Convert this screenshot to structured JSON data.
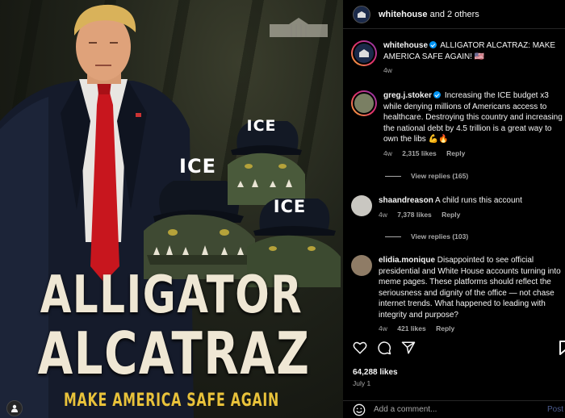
{
  "poster": {
    "cap_text": "ICE",
    "headline_line1": "ALLIGATOR",
    "headline_line2": "ALCATRAZ",
    "tagline": "MAKE AMERICA SAFE AGAIN"
  },
  "header": {
    "username": "whitehouse",
    "suffix": "and 2 others"
  },
  "caption": {
    "username": "whitehouse",
    "text": "ALLIGATOR ALCATRAZ: MAKE AMERICA SAFE AGAIN! 🇺🇸",
    "time": "4w"
  },
  "comments": [
    {
      "username": "greg.j.stoker",
      "text": "Increasing the ICE budget x3 while denying millions of Americans access to healthcare. Destroying this country and increasing the national debt by 4.5 trillion is a great way to own the libs 💪🔥",
      "time": "4w",
      "likes": "2,315 likes",
      "reply": "Reply",
      "view_replies": "View replies (165)"
    },
    {
      "username": "shaandreason",
      "text": "A child runs this account",
      "time": "4w",
      "likes": "7,378 likes",
      "reply": "Reply",
      "view_replies": "View replies (103)"
    },
    {
      "username": "elidia.monique",
      "text": "Disappointed to see official presidential and White House accounts turning into meme pages. These platforms should reflect the seriousness and dignity of the office — not chase internet trends. What happened to leading with integrity and purpose?",
      "time": "4w",
      "likes": "421 likes",
      "reply": "Reply"
    }
  ],
  "footer": {
    "likes": "64,288 likes",
    "date": "July 1",
    "comment_placeholder": "Add a comment...",
    "post_label": "Post"
  },
  "icons": [
    "heart-icon",
    "comment-icon",
    "share-icon",
    "save-icon",
    "emoji-icon",
    "user-tag-icon"
  ],
  "colors": {
    "verified": "#0095f6",
    "tagline": "#e8c23a",
    "headline": "#efe7d4"
  }
}
